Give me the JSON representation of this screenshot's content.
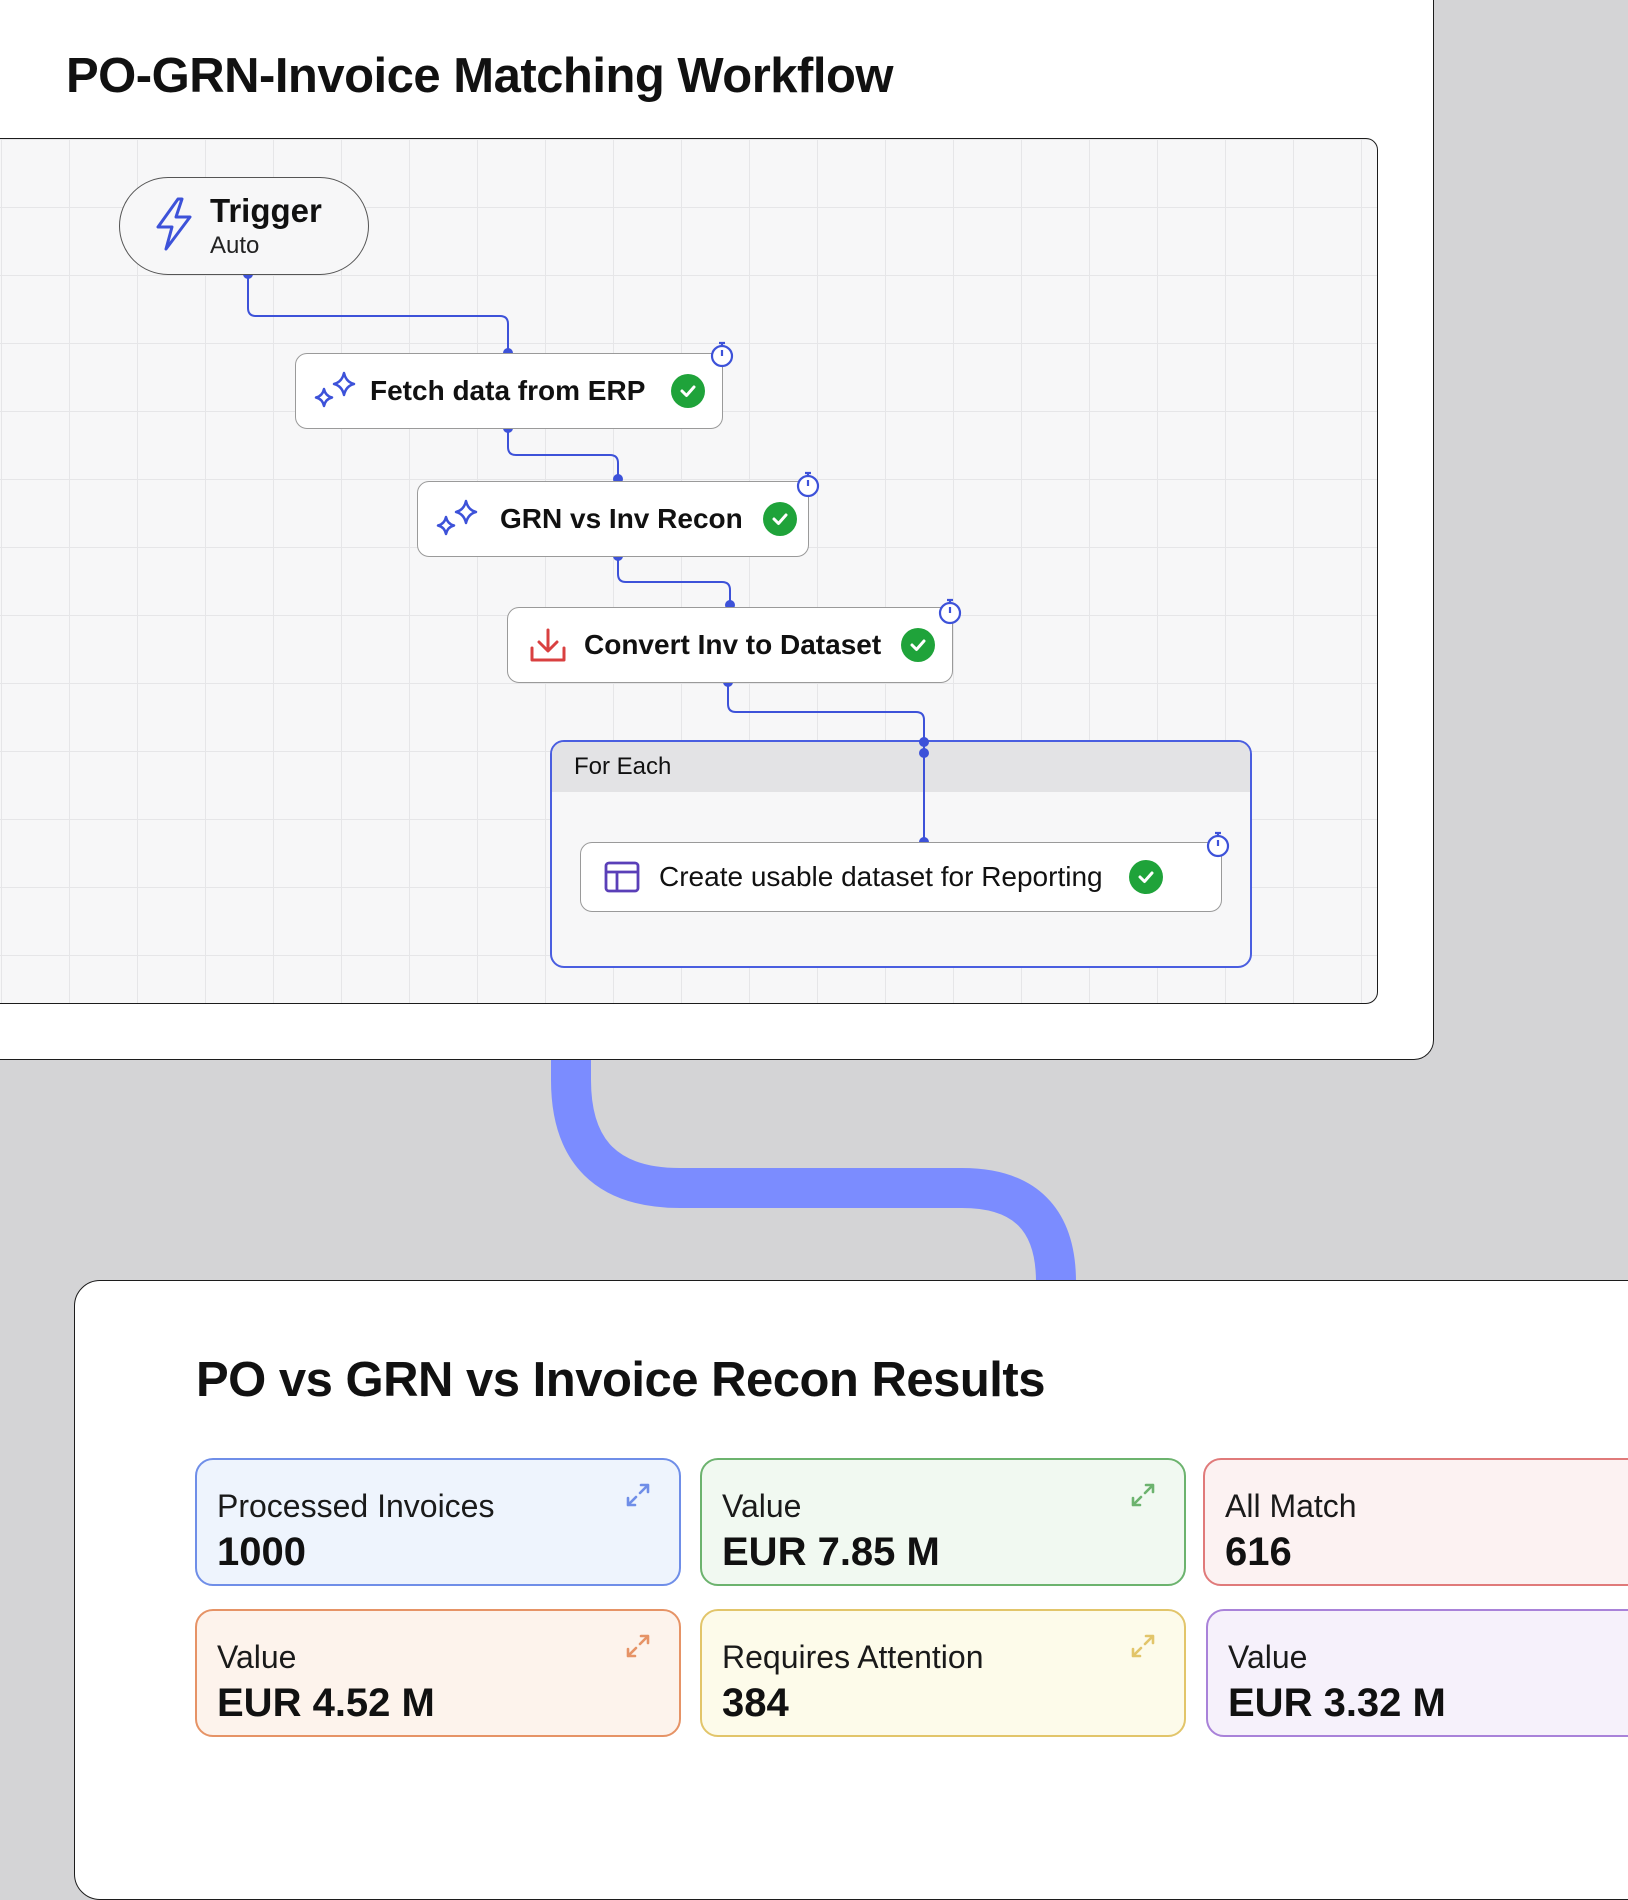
{
  "workflow": {
    "title": "PO-GRN-Invoice Matching Workflow",
    "trigger": {
      "title": "Trigger",
      "subtitle": "Auto"
    },
    "steps": [
      {
        "label": "Fetch data from ERP",
        "icon": "sparkles-icon",
        "status": "success"
      },
      {
        "label": "GRN vs Inv Recon",
        "icon": "sparkles-icon",
        "status": "success"
      },
      {
        "label": "Convert Inv to Dataset",
        "icon": "download-icon",
        "status": "success"
      },
      {
        "label": "Create usable dataset for Reporting",
        "icon": "table-icon",
        "status": "success"
      }
    ],
    "loop_label": "For Each",
    "accent_color": "#4a5ee0",
    "success_color": "#1fa33a",
    "connector_color": "#7b8cff"
  },
  "results": {
    "title": "PO vs GRN vs Invoice Recon Results",
    "cards": [
      {
        "label": "Processed Invoices",
        "value": "1000",
        "color": "#6f8ee8",
        "bg": "#eef4fd",
        "icon": "expand-icon"
      },
      {
        "label": "Value",
        "value": "EUR 7.85 M",
        "color": "#6cb36e",
        "bg": "#f1f9f1",
        "icon": "expand-icon"
      },
      {
        "label": "All Match",
        "value": "616",
        "color": "#e07a7a",
        "bg": "#fcf2f2",
        "icon": "expand-icon"
      },
      {
        "label": "Value",
        "value": "EUR 4.52 M",
        "color": "#e69366",
        "bg": "#fdf3ec",
        "icon": "expand-icon"
      },
      {
        "label": "Requires Attention",
        "value": "384",
        "color": "#e2c56a",
        "bg": "#fdfbea",
        "icon": "expand-icon"
      },
      {
        "label": "Value",
        "value": "EUR 3.32 M",
        "color": "#a982d9",
        "bg": "#f6f1fb",
        "icon": "expand-icon"
      }
    ]
  }
}
